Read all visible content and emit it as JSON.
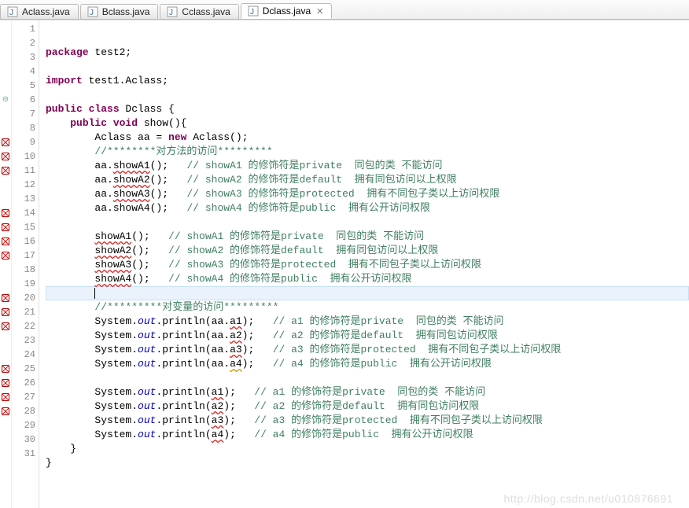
{
  "tabs": {
    "items": [
      {
        "label": "Aclass.java",
        "active": false
      },
      {
        "label": "Bclass.java",
        "active": false
      },
      {
        "label": "Cclass.java",
        "active": false
      },
      {
        "label": "Dclass.java",
        "active": true
      }
    ],
    "close_glyph": "✕"
  },
  "editor": {
    "filename": "Dclass.java",
    "highlighted_line": 18,
    "lines": [
      {
        "n": 1,
        "marker": null,
        "tokens": [
          {
            "t": "package ",
            "c": "kw"
          },
          {
            "t": "test2;"
          }
        ]
      },
      {
        "n": 2,
        "marker": null,
        "tokens": []
      },
      {
        "n": 3,
        "marker": null,
        "tokens": [
          {
            "t": "import ",
            "c": "kw"
          },
          {
            "t": "test1.Aclass;"
          }
        ]
      },
      {
        "n": 4,
        "marker": null,
        "tokens": []
      },
      {
        "n": 5,
        "marker": null,
        "tokens": [
          {
            "t": "public class ",
            "c": "kw"
          },
          {
            "t": "Dclass {"
          }
        ]
      },
      {
        "n": 6,
        "marker": "fold",
        "tokens": [
          {
            "t": "    "
          },
          {
            "t": "public void ",
            "c": "kw"
          },
          {
            "t": "show(){"
          }
        ]
      },
      {
        "n": 7,
        "marker": null,
        "tokens": [
          {
            "t": "        Aclass aa = "
          },
          {
            "t": "new ",
            "c": "kw"
          },
          {
            "t": "Aclass();"
          }
        ]
      },
      {
        "n": 8,
        "marker": null,
        "tokens": [
          {
            "t": "        "
          },
          {
            "t": "//********对方法的访问*********",
            "c": "cm"
          }
        ]
      },
      {
        "n": 9,
        "marker": "error",
        "tokens": [
          {
            "t": "        aa."
          },
          {
            "t": "showA1",
            "c": "err-und"
          },
          {
            "t": "();   "
          },
          {
            "t": "// showA1 的修饰符是private  同包的类 不能访问",
            "c": "cm"
          }
        ]
      },
      {
        "n": 10,
        "marker": "error",
        "tokens": [
          {
            "t": "        aa."
          },
          {
            "t": "showA2",
            "c": "err-und"
          },
          {
            "t": "();   "
          },
          {
            "t": "// showA2 的修饰符是default  拥有同包访问以上权限",
            "c": "cm"
          }
        ]
      },
      {
        "n": 11,
        "marker": "error",
        "tokens": [
          {
            "t": "        aa."
          },
          {
            "t": "showA3",
            "c": "err-und"
          },
          {
            "t": "();   "
          },
          {
            "t": "// showA3 的修饰符是protected  拥有不同包子类以上访问权限",
            "c": "cm"
          }
        ]
      },
      {
        "n": 12,
        "marker": null,
        "tokens": [
          {
            "t": "        aa.showA4();   "
          },
          {
            "t": "// showA4 的修饰符是public  拥有公开访问权限",
            "c": "cm"
          }
        ]
      },
      {
        "n": 13,
        "marker": null,
        "tokens": []
      },
      {
        "n": 14,
        "marker": "error",
        "tokens": [
          {
            "t": "        "
          },
          {
            "t": "showA1",
            "c": "err-und"
          },
          {
            "t": "();   "
          },
          {
            "t": "// showA1 的修饰符是private  同包的类 不能访问",
            "c": "cm"
          }
        ]
      },
      {
        "n": 15,
        "marker": "error",
        "tokens": [
          {
            "t": "        "
          },
          {
            "t": "showA2",
            "c": "err-und"
          },
          {
            "t": "();   "
          },
          {
            "t": "// showA2 的修饰符是default  拥有同包访问以上权限",
            "c": "cm"
          }
        ]
      },
      {
        "n": 16,
        "marker": "error",
        "tokens": [
          {
            "t": "        "
          },
          {
            "t": "showA3",
            "c": "err-und"
          },
          {
            "t": "();   "
          },
          {
            "t": "// showA3 的修饰符是protected  拥有不同包子类以上访问权限",
            "c": "cm"
          }
        ]
      },
      {
        "n": 17,
        "marker": "error",
        "tokens": [
          {
            "t": "        "
          },
          {
            "t": "showA4",
            "c": "err-und"
          },
          {
            "t": "();   "
          },
          {
            "t": "// showA4 的修饰符是public  拥有公开访问权限",
            "c": "cm"
          }
        ]
      },
      {
        "n": 18,
        "marker": null,
        "tokens": [
          {
            "t": "        "
          },
          {
            "t": "",
            "caret": true
          }
        ]
      },
      {
        "n": 19,
        "marker": null,
        "tokens": [
          {
            "t": "        "
          },
          {
            "t": "//*********对变量的访问*********",
            "c": "cm"
          }
        ]
      },
      {
        "n": 20,
        "marker": "error",
        "tokens": [
          {
            "t": "        System."
          },
          {
            "t": "out",
            "c": "fld"
          },
          {
            "t": ".println(aa."
          },
          {
            "t": "a1",
            "c": "err-und"
          },
          {
            "t": ");   "
          },
          {
            "t": "// a1 的修饰符是private  同包的类 不能访问",
            "c": "cm"
          }
        ]
      },
      {
        "n": 21,
        "marker": "error",
        "tokens": [
          {
            "t": "        System."
          },
          {
            "t": "out",
            "c": "fld"
          },
          {
            "t": ".println(aa."
          },
          {
            "t": "a2",
            "c": "err-und"
          },
          {
            "t": ");   "
          },
          {
            "t": "// a2 的修饰符是default  拥有同包访问权限",
            "c": "cm"
          }
        ]
      },
      {
        "n": 22,
        "marker": "error",
        "tokens": [
          {
            "t": "        System."
          },
          {
            "t": "out",
            "c": "fld"
          },
          {
            "t": ".println(aa."
          },
          {
            "t": "a3",
            "c": "err-und"
          },
          {
            "t": ");   "
          },
          {
            "t": "// a3 的修饰符是protected  拥有不同包子类以上访问权限",
            "c": "cm"
          }
        ]
      },
      {
        "n": 23,
        "marker": null,
        "tokens": [
          {
            "t": "        System."
          },
          {
            "t": "out",
            "c": "fld"
          },
          {
            "t": ".println(aa."
          },
          {
            "t": "a4",
            "c": "warn-und"
          },
          {
            "t": ");   "
          },
          {
            "t": "// a4 的修饰符是public  拥有公开访问权限",
            "c": "cm"
          }
        ]
      },
      {
        "n": 24,
        "marker": null,
        "tokens": []
      },
      {
        "n": 25,
        "marker": "error",
        "tokens": [
          {
            "t": "        System."
          },
          {
            "t": "out",
            "c": "fld"
          },
          {
            "t": ".println("
          },
          {
            "t": "a1",
            "c": "err-und"
          },
          {
            "t": ");   "
          },
          {
            "t": "// a1 的修饰符是private  同包的类 不能访问",
            "c": "cm"
          }
        ]
      },
      {
        "n": 26,
        "marker": "error",
        "tokens": [
          {
            "t": "        System."
          },
          {
            "t": "out",
            "c": "fld"
          },
          {
            "t": ".println("
          },
          {
            "t": "a2",
            "c": "err-und"
          },
          {
            "t": ");   "
          },
          {
            "t": "// a2 的修饰符是default  拥有同包访问权限",
            "c": "cm"
          }
        ]
      },
      {
        "n": 27,
        "marker": "error",
        "tokens": [
          {
            "t": "        System."
          },
          {
            "t": "out",
            "c": "fld"
          },
          {
            "t": ".println("
          },
          {
            "t": "a3",
            "c": "err-und"
          },
          {
            "t": ");   "
          },
          {
            "t": "// a3 的修饰符是protected  拥有不同包子类以上访问权限",
            "c": "cm"
          }
        ]
      },
      {
        "n": 28,
        "marker": "error",
        "tokens": [
          {
            "t": "        System."
          },
          {
            "t": "out",
            "c": "fld"
          },
          {
            "t": ".println("
          },
          {
            "t": "a4",
            "c": "err-und"
          },
          {
            "t": ");   "
          },
          {
            "t": "// a4 的修饰符是public  拥有公开访问权限",
            "c": "cm"
          }
        ]
      },
      {
        "n": 29,
        "marker": null,
        "tokens": [
          {
            "t": "    }"
          }
        ]
      },
      {
        "n": 30,
        "marker": null,
        "tokens": [
          {
            "t": "}"
          }
        ]
      },
      {
        "n": 31,
        "marker": null,
        "tokens": []
      }
    ]
  },
  "watermark": "http://blog.csdn.net/u010876691"
}
